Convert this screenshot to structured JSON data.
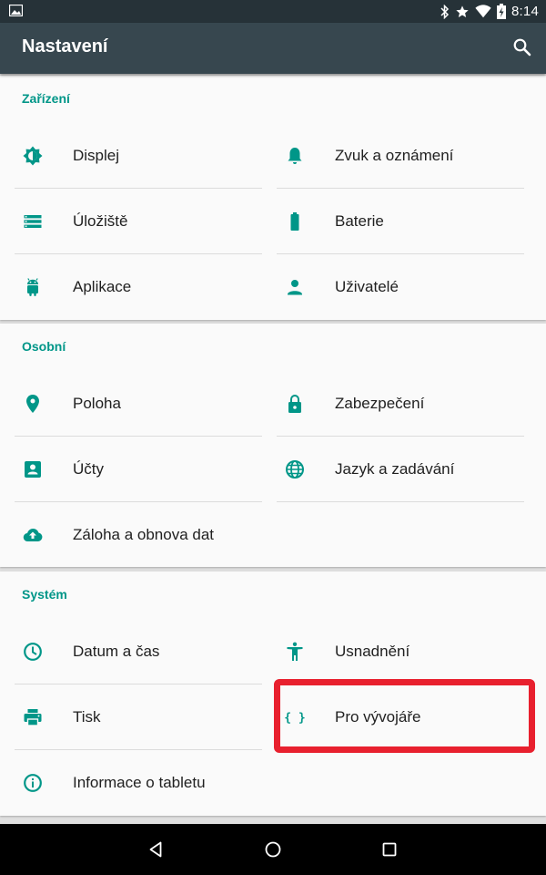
{
  "status_bar": {
    "time": "8:14",
    "icons": [
      "image-icon",
      "bluetooth-icon",
      "star-icon",
      "wifi-icon",
      "battery-charging-icon"
    ]
  },
  "toolbar": {
    "title": "Nastavení",
    "search_icon": "search-icon"
  },
  "sections": [
    {
      "title": "Zařízení",
      "items": [
        {
          "label": "Displej",
          "icon": "brightness-icon"
        },
        {
          "label": "Zvuk a oznámení",
          "icon": "bell-icon"
        },
        {
          "label": "Úložiště",
          "icon": "storage-icon"
        },
        {
          "label": "Baterie",
          "icon": "battery-icon"
        },
        {
          "label": "Aplikace",
          "icon": "android-icon"
        },
        {
          "label": "Uživatelé",
          "icon": "person-icon"
        }
      ]
    },
    {
      "title": "Osobní",
      "items": [
        {
          "label": "Poloha",
          "icon": "location-pin-icon"
        },
        {
          "label": "Zabezpečení",
          "icon": "lock-icon"
        },
        {
          "label": "Účty",
          "icon": "account-box-icon"
        },
        {
          "label": "Jazyk a zadávání",
          "icon": "globe-icon"
        },
        {
          "label": "Záloha a obnova dat",
          "icon": "cloud-upload-icon"
        }
      ]
    },
    {
      "title": "Systém",
      "items": [
        {
          "label": "Datum a čas",
          "icon": "clock-icon"
        },
        {
          "label": "Usnadnění",
          "icon": "accessibility-icon"
        },
        {
          "label": "Tisk",
          "icon": "printer-icon"
        },
        {
          "label": "Pro vývojáře",
          "icon": "developer-braces-icon"
        },
        {
          "label": "Informace o tabletu",
          "icon": "info-icon"
        }
      ]
    }
  ],
  "highlighted_item": "Pro vývojáře",
  "highlight_color": "#e8202e",
  "colors": {
    "accent": "#009688",
    "toolbar": "#37474f",
    "status_bar": "#263238",
    "background": "#e0e0e0",
    "card": "#fafafa"
  },
  "nav_bar": {
    "buttons": [
      "back-icon",
      "home-icon",
      "recents-icon"
    ]
  }
}
